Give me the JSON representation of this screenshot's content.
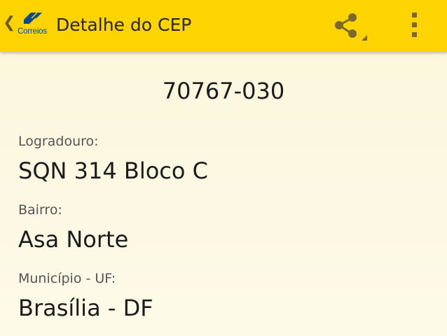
{
  "app": {
    "logo_text": "Correios",
    "title": "Detalhe do CEP",
    "colors": {
      "action_bar": "#fed400",
      "logo_blue": "#0d4a8c",
      "logo_yellow": "#f7c600",
      "background": "#fcf8e3"
    }
  },
  "toolbar": {
    "up_icon": "chevron-left-icon",
    "share_icon": "share-icon",
    "overflow_icon": "overflow-menu-icon"
  },
  "cep": {
    "value": "70767-030"
  },
  "fields": [
    {
      "label": "Logradouro:",
      "value": "SQN 314 Bloco C"
    },
    {
      "label": "Bairro:",
      "value": "Asa Norte"
    },
    {
      "label": "Município - UF:",
      "value": "Brasília - DF"
    }
  ]
}
